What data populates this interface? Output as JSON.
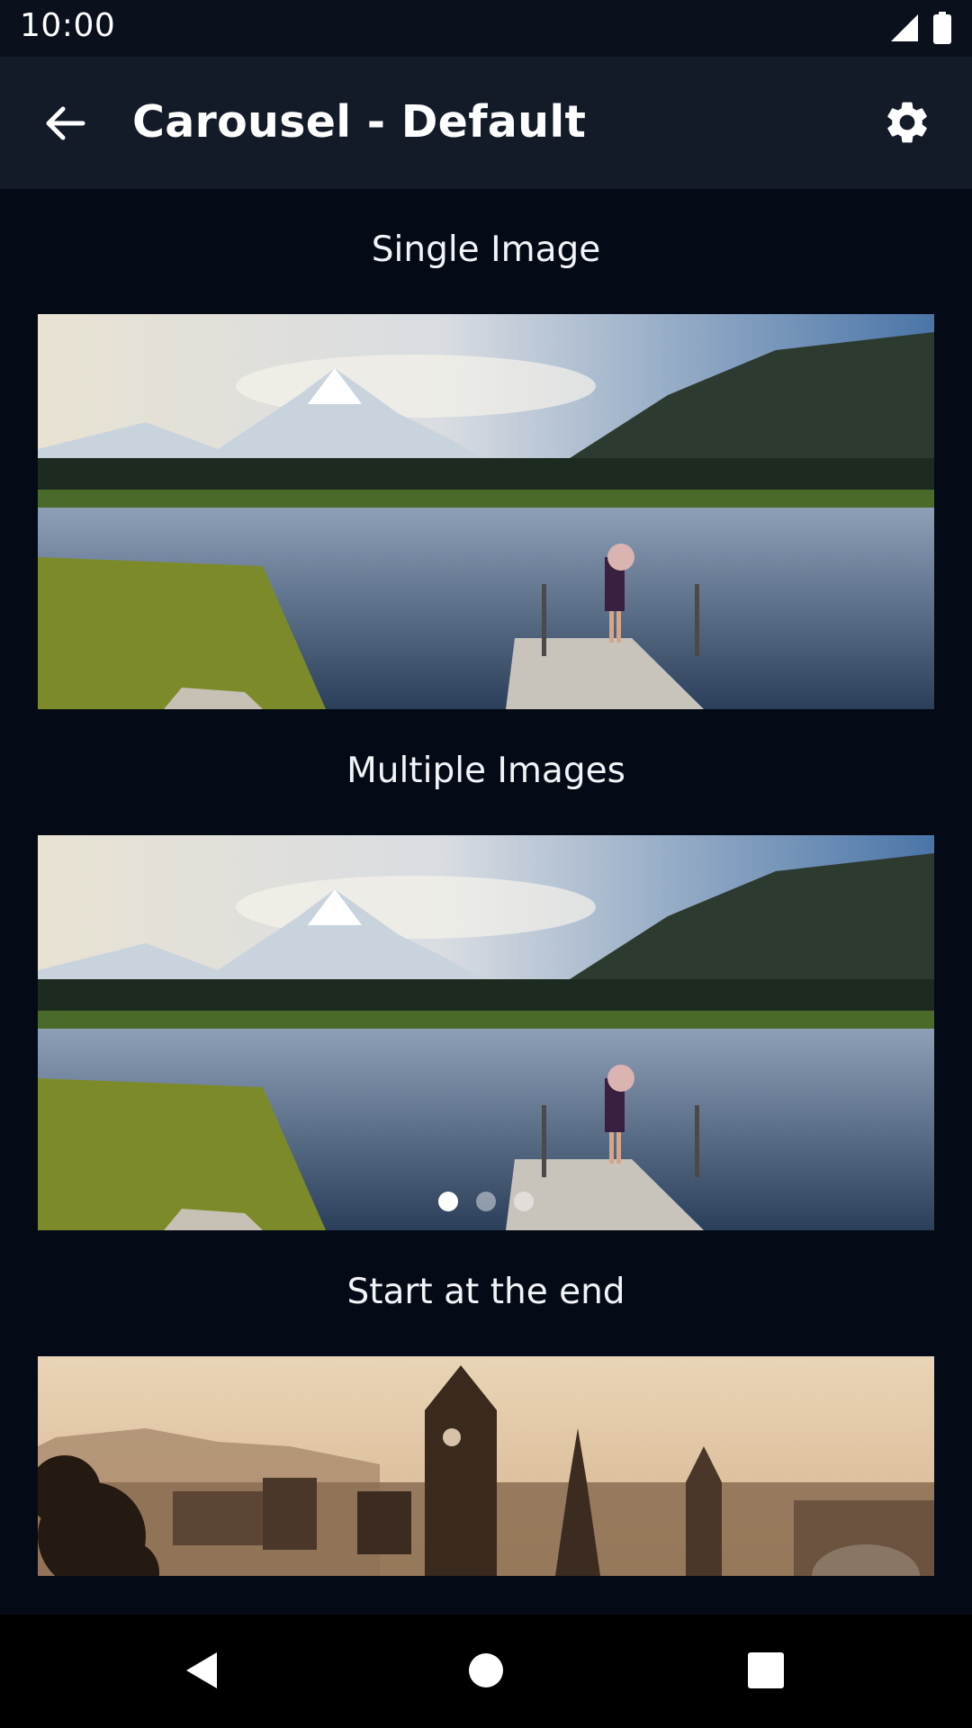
{
  "status": {
    "time": "10:00"
  },
  "app_bar": {
    "title": "Carousel - Default"
  },
  "sections": [
    {
      "title": "Single Image"
    },
    {
      "title": "Multiple Images",
      "pages": 3,
      "active_page": 1
    },
    {
      "title": "Start at the end"
    }
  ],
  "icons": {
    "back": "arrow-back-icon",
    "settings": "gear-icon",
    "signal": "signal-icon",
    "battery": "battery-icon",
    "nav_back": "nav-back-icon",
    "nav_home": "nav-home-icon",
    "nav_recents": "nav-recents-icon"
  },
  "colors": {
    "background": "#050b16",
    "app_bar": "#141b28",
    "status_bar": "#0b111c"
  }
}
